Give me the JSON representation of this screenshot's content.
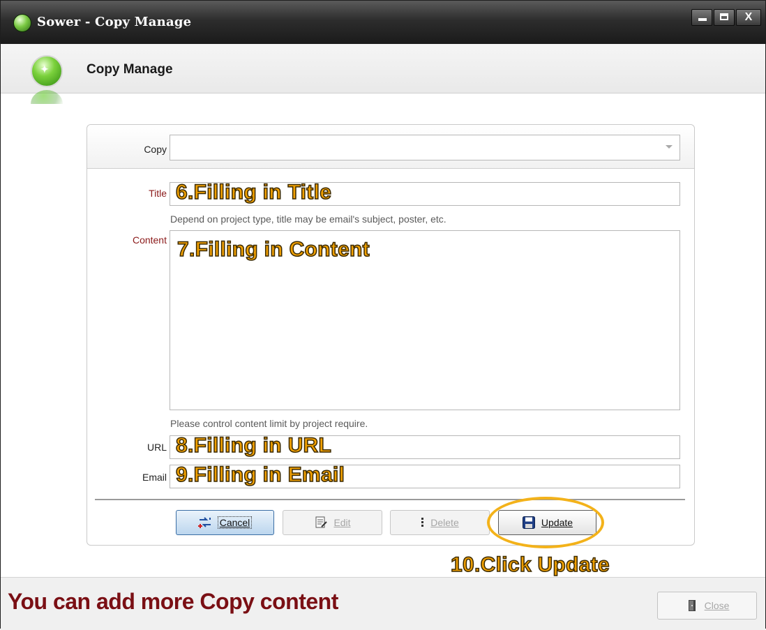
{
  "window": {
    "title": "Sower - Copy Manage",
    "controls": {
      "minimize": "minimize",
      "maximize": "maximize",
      "close": "X"
    }
  },
  "header": {
    "title": "Copy Manage"
  },
  "form": {
    "copy": {
      "label": "Copy",
      "value": ""
    },
    "title": {
      "label": "Title",
      "annotation": "6.Filling in Title",
      "hint": "Depend on project type, title may be email's subject, poster, etc."
    },
    "content": {
      "label": "Content",
      "annotation": "7.Filling in Content",
      "hint": "Please control content limit by project require."
    },
    "url": {
      "label": "URL",
      "annotation": "8.Filling in URL"
    },
    "email": {
      "label": "Email",
      "annotation": "9.Filling in Email"
    }
  },
  "buttons": {
    "cancel": "Cancel",
    "edit": "Edit",
    "delete": "Delete",
    "update": "Update",
    "close": "Close"
  },
  "annotations": {
    "update_step": "10.Click Update",
    "footer_note": "You can add more Copy content"
  },
  "colors": {
    "annotation_fill": "#f0a000",
    "annotation_ring": "#f3b21a",
    "footer_note": "#7a0f14",
    "required_label": "#8b1a1a"
  },
  "icons": {
    "app": "green-orb-icon",
    "cancel": "cancel-arrows-icon",
    "edit": "edit-document-icon",
    "delete": "delete-icon",
    "update": "floppy-disk-icon",
    "close": "door-icon"
  }
}
